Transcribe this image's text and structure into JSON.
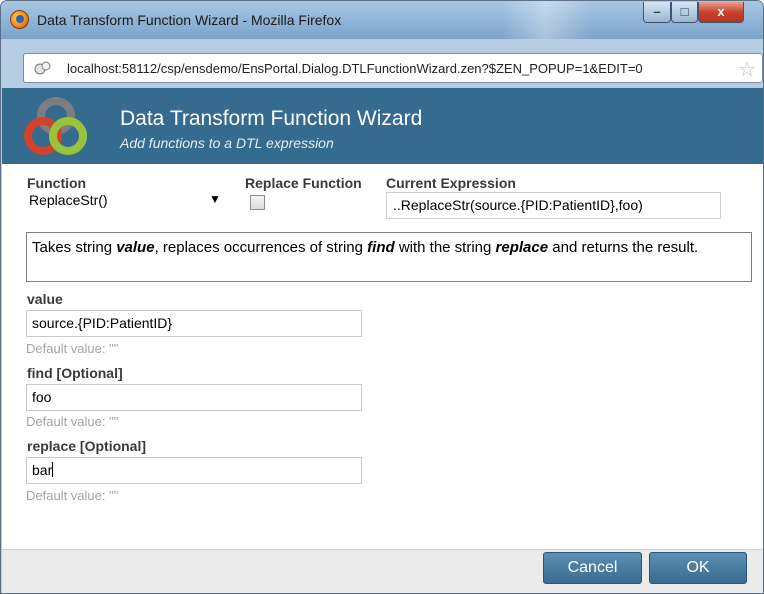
{
  "window": {
    "title": "Data Transform Function Wizard - Mozilla Firefox",
    "min_glyph": "–",
    "max_glyph": "□",
    "close_glyph": "x"
  },
  "address_bar": {
    "url": "localhost:58112/csp/ensdemo/EnsPortal.Dialog.DTLFunctionWizard.zen?$ZEN_POPUP=1&EDIT=0"
  },
  "header": {
    "title": "Data Transform Function Wizard",
    "subtitle": "Add functions to a DTL expression"
  },
  "form": {
    "function_label": "Function",
    "function_value": "ReplaceStr()",
    "replace_label": "Replace Function",
    "replace_checked": false,
    "expression_label": "Current Expression",
    "expression_value": "..ReplaceStr(source.{PID:PatientID},foo)",
    "description": {
      "p1": "Takes string ",
      "w1": "value",
      "p2": ", replaces occurrences of string ",
      "w2": "find",
      "p3": " with the string ",
      "w3": "replace",
      "p4": " and returns the result."
    },
    "params": [
      {
        "label": "value",
        "value": "source.{PID:PatientID}",
        "hint": "Default value: \"\""
      },
      {
        "label": "find [Optional]",
        "value": "foo",
        "hint": "Default value: \"\""
      },
      {
        "label": "replace [Optional]",
        "value": "bar",
        "hint": "Default value: \"\""
      }
    ]
  },
  "footer": {
    "cancel_label": "Cancel",
    "ok_label": "OK"
  },
  "colors": {
    "header_bg": "#356b8f",
    "button_bg": "#3b6c90"
  }
}
